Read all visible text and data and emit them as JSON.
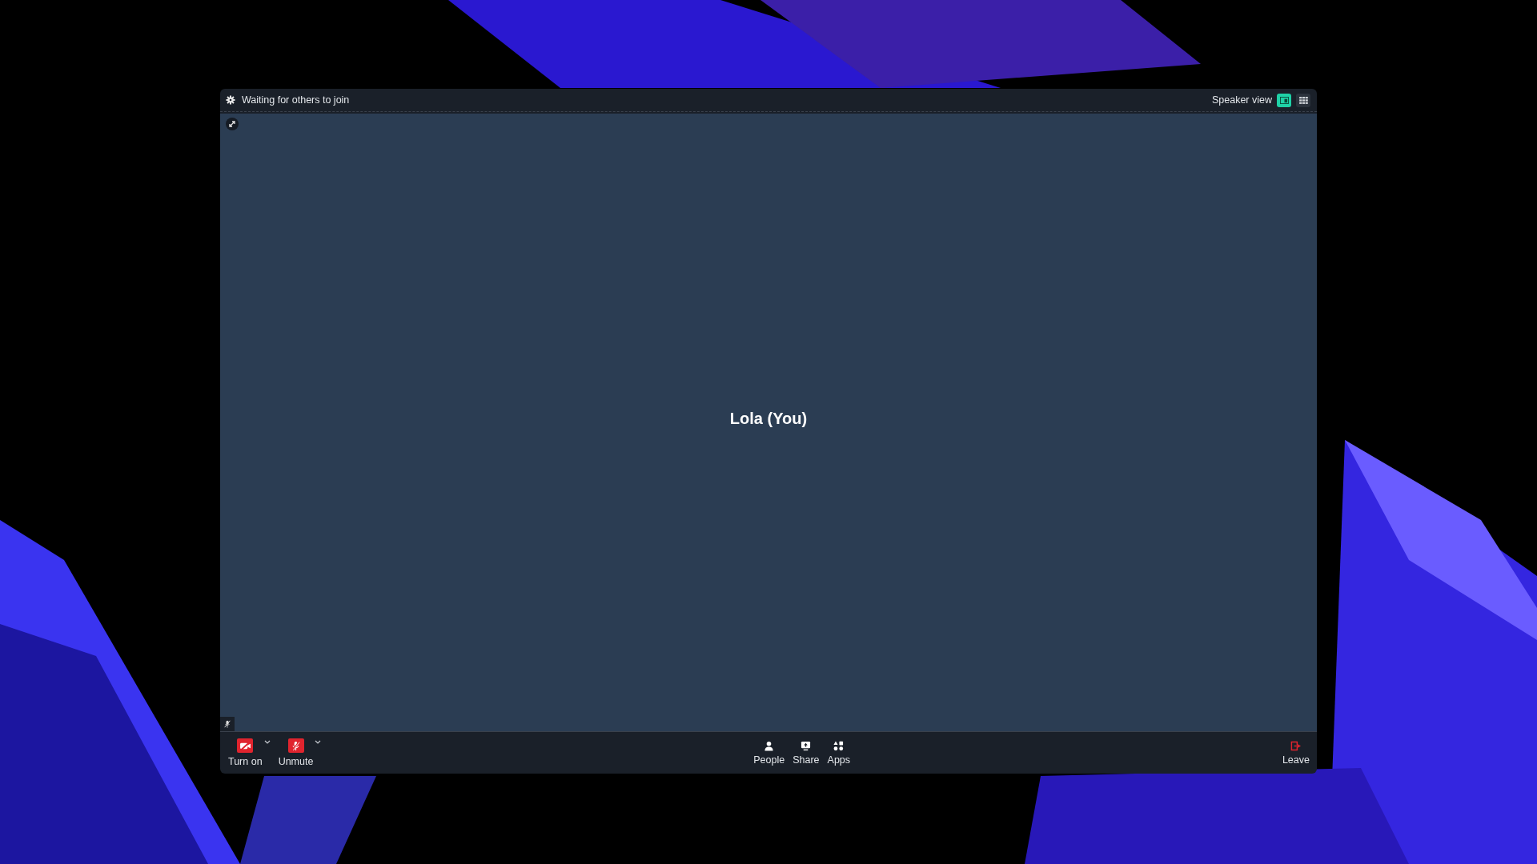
{
  "window": {
    "title": "Waiting for others to join",
    "layout_label": "Speaker view",
    "layout_buttons": [
      {
        "kind": "speaker",
        "selected": true
      },
      {
        "kind": "gallery",
        "selected": false
      }
    ]
  },
  "video": {
    "participant": "Lola (You)",
    "muted": true
  },
  "toolbar": {
    "left": [
      {
        "kind": "video",
        "label": "Turn on",
        "dropdown": true
      },
      {
        "kind": "audio",
        "label": "Unmute",
        "dropdown": true
      }
    ],
    "center": [
      {
        "kind": "people",
        "label": "People"
      },
      {
        "kind": "share",
        "label": "Share"
      },
      {
        "kind": "apps",
        "label": "Apps"
      }
    ],
    "right": [
      {
        "kind": "leave",
        "label": "Leave"
      }
    ]
  }
}
